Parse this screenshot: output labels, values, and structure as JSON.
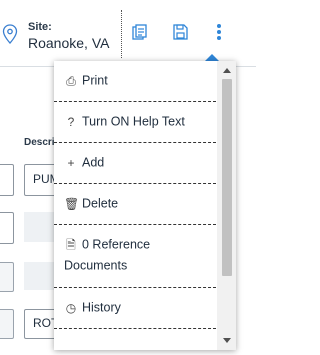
{
  "header": {
    "site_label": "Site:",
    "site_value": "Roanoke, VA",
    "icons": [
      "location-pin-icon",
      "documents-icon",
      "save-icon",
      "more-vertical-icon"
    ]
  },
  "form": {
    "description_label": "Descrip",
    "field_1_value": "PUM",
    "field_2_value": "ROT"
  },
  "menu": {
    "items": [
      {
        "icon": "print-icon",
        "glyph": "⎙",
        "label": "Print"
      },
      {
        "icon": "help-icon",
        "glyph": "?",
        "label": "Turn ON Help Text"
      },
      {
        "icon": "plus-icon",
        "glyph": "+",
        "label": "Add"
      },
      {
        "icon": "trash-icon",
        "glyph": "🗑",
        "label": "Delete"
      },
      {
        "icon": "document-icon",
        "glyph": "🗎",
        "label": "0 Reference Documents"
      },
      {
        "icon": "clock-icon",
        "glyph": "◷",
        "label": "History"
      }
    ]
  },
  "colors": {
    "accent": "#2f86d8",
    "text": "#1f2d3d"
  }
}
